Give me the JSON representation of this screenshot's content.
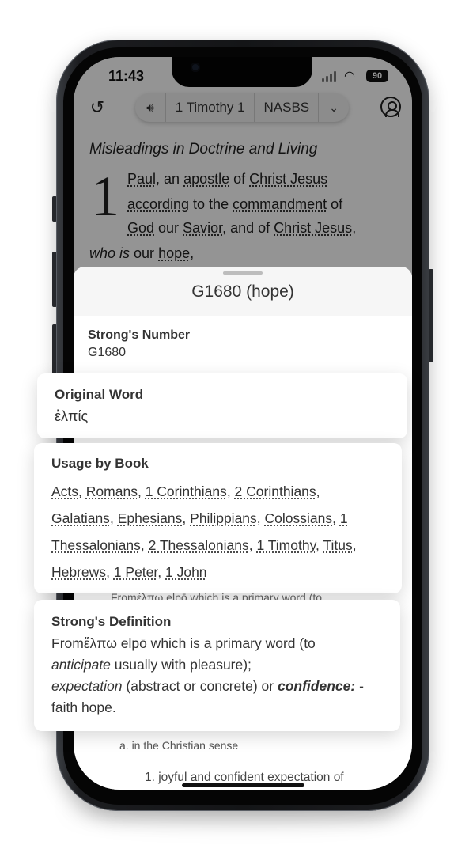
{
  "status": {
    "time": "11:43",
    "battery": "90",
    "wifi_icon": "wifi-icon",
    "signal_icon": "cellular-signal-icon"
  },
  "top_bar": {
    "history_icon": "history-icon",
    "audio_icon": "speaker-icon",
    "book_chapter": "1 Timothy 1",
    "version": "NASBS",
    "dropdown_icon": "chevron-down-icon",
    "profile_icon": "account-circle-icon"
  },
  "bible": {
    "section_heading": "Misleadings in Doctrine and Living",
    "chapter_number": "1",
    "verse": {
      "line1": {
        "w1": "Paul",
        "t1": ", an ",
        "w2": "apostle",
        "t2": " of ",
        "w3": "Christ Jesus"
      },
      "line2": {
        "w1": "according",
        "t1": " to the ",
        "w2": "commandment",
        "t2": " of"
      },
      "line3": {
        "w1": "God",
        "t1": " our ",
        "w2": "Savior",
        "t2": ", and of ",
        "w3": "Christ Jesus",
        "t3": ","
      },
      "line4": {
        "t1": "who is",
        "t2": " our ",
        "w1": "hope",
        "t3": ","
      }
    }
  },
  "sheet": {
    "title": "G1680 (hope)",
    "strongs_number_label": "Strong's Number",
    "strongs_number_value": "G1680",
    "original_word_label": "Original Word",
    "original_word_value": "ἐλπίς",
    "usage_label": "Usage by Book",
    "usage_books": [
      "Acts",
      "Romans",
      "1 Corinthians",
      "2 Corinthians",
      "Galatians",
      "Ephesians",
      "Philippians",
      "Colossians",
      "1 Thessalonians",
      "2 Thessalonians",
      "1 Timothy",
      "Titus",
      "Hebrews",
      "1 Peter",
      "1 John"
    ],
    "definition_label": "Strong's Definition",
    "definition": {
      "p1": "Fromἔλπω elpō which is a primary word (to",
      "p2_em": "anticipate",
      "p2": " usually with pleasure);",
      "p3_em": "expectation",
      "p3": " (abstract or concrete) or ",
      "p3_strong": "confidence:",
      "p3_end": " -",
      "p4": "faith hope."
    },
    "peek_text": "Fromἔλπω elpō which is a primary word (to",
    "outline_a": "a.  in the Christian sense",
    "outline_1": "1.  joyful and confident expectation of",
    "outline_1_underlined": "ful and confident ex"
  }
}
